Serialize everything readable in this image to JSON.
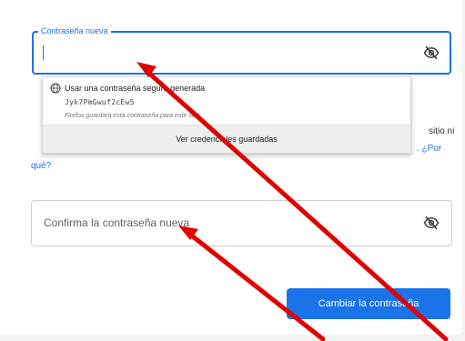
{
  "new_password": {
    "label": "Contraseña nueva",
    "value": "",
    "eye_icon": "eye-off-icon"
  },
  "suggestion": {
    "title": "Usar una contraseña segura generada",
    "password": "Jyk7PmGwuf2cEw5",
    "note": "Firefox guardará esta contraseña para este sitio.",
    "footer": "Ver credenciales guardadas",
    "icon": "globe-icon"
  },
  "paragraph": {
    "line1_end": "sitio ni",
    "link_end": ". ¿Por",
    "link_start": "qué?"
  },
  "confirm_password": {
    "placeholder": "Confirma la contraseña nueva",
    "eye_icon": "eye-off-icon"
  },
  "submit": {
    "label": "Cambiar la contraseña"
  },
  "colors": {
    "accent": "#1a73e8",
    "annotation_arrow": "#e00000"
  }
}
